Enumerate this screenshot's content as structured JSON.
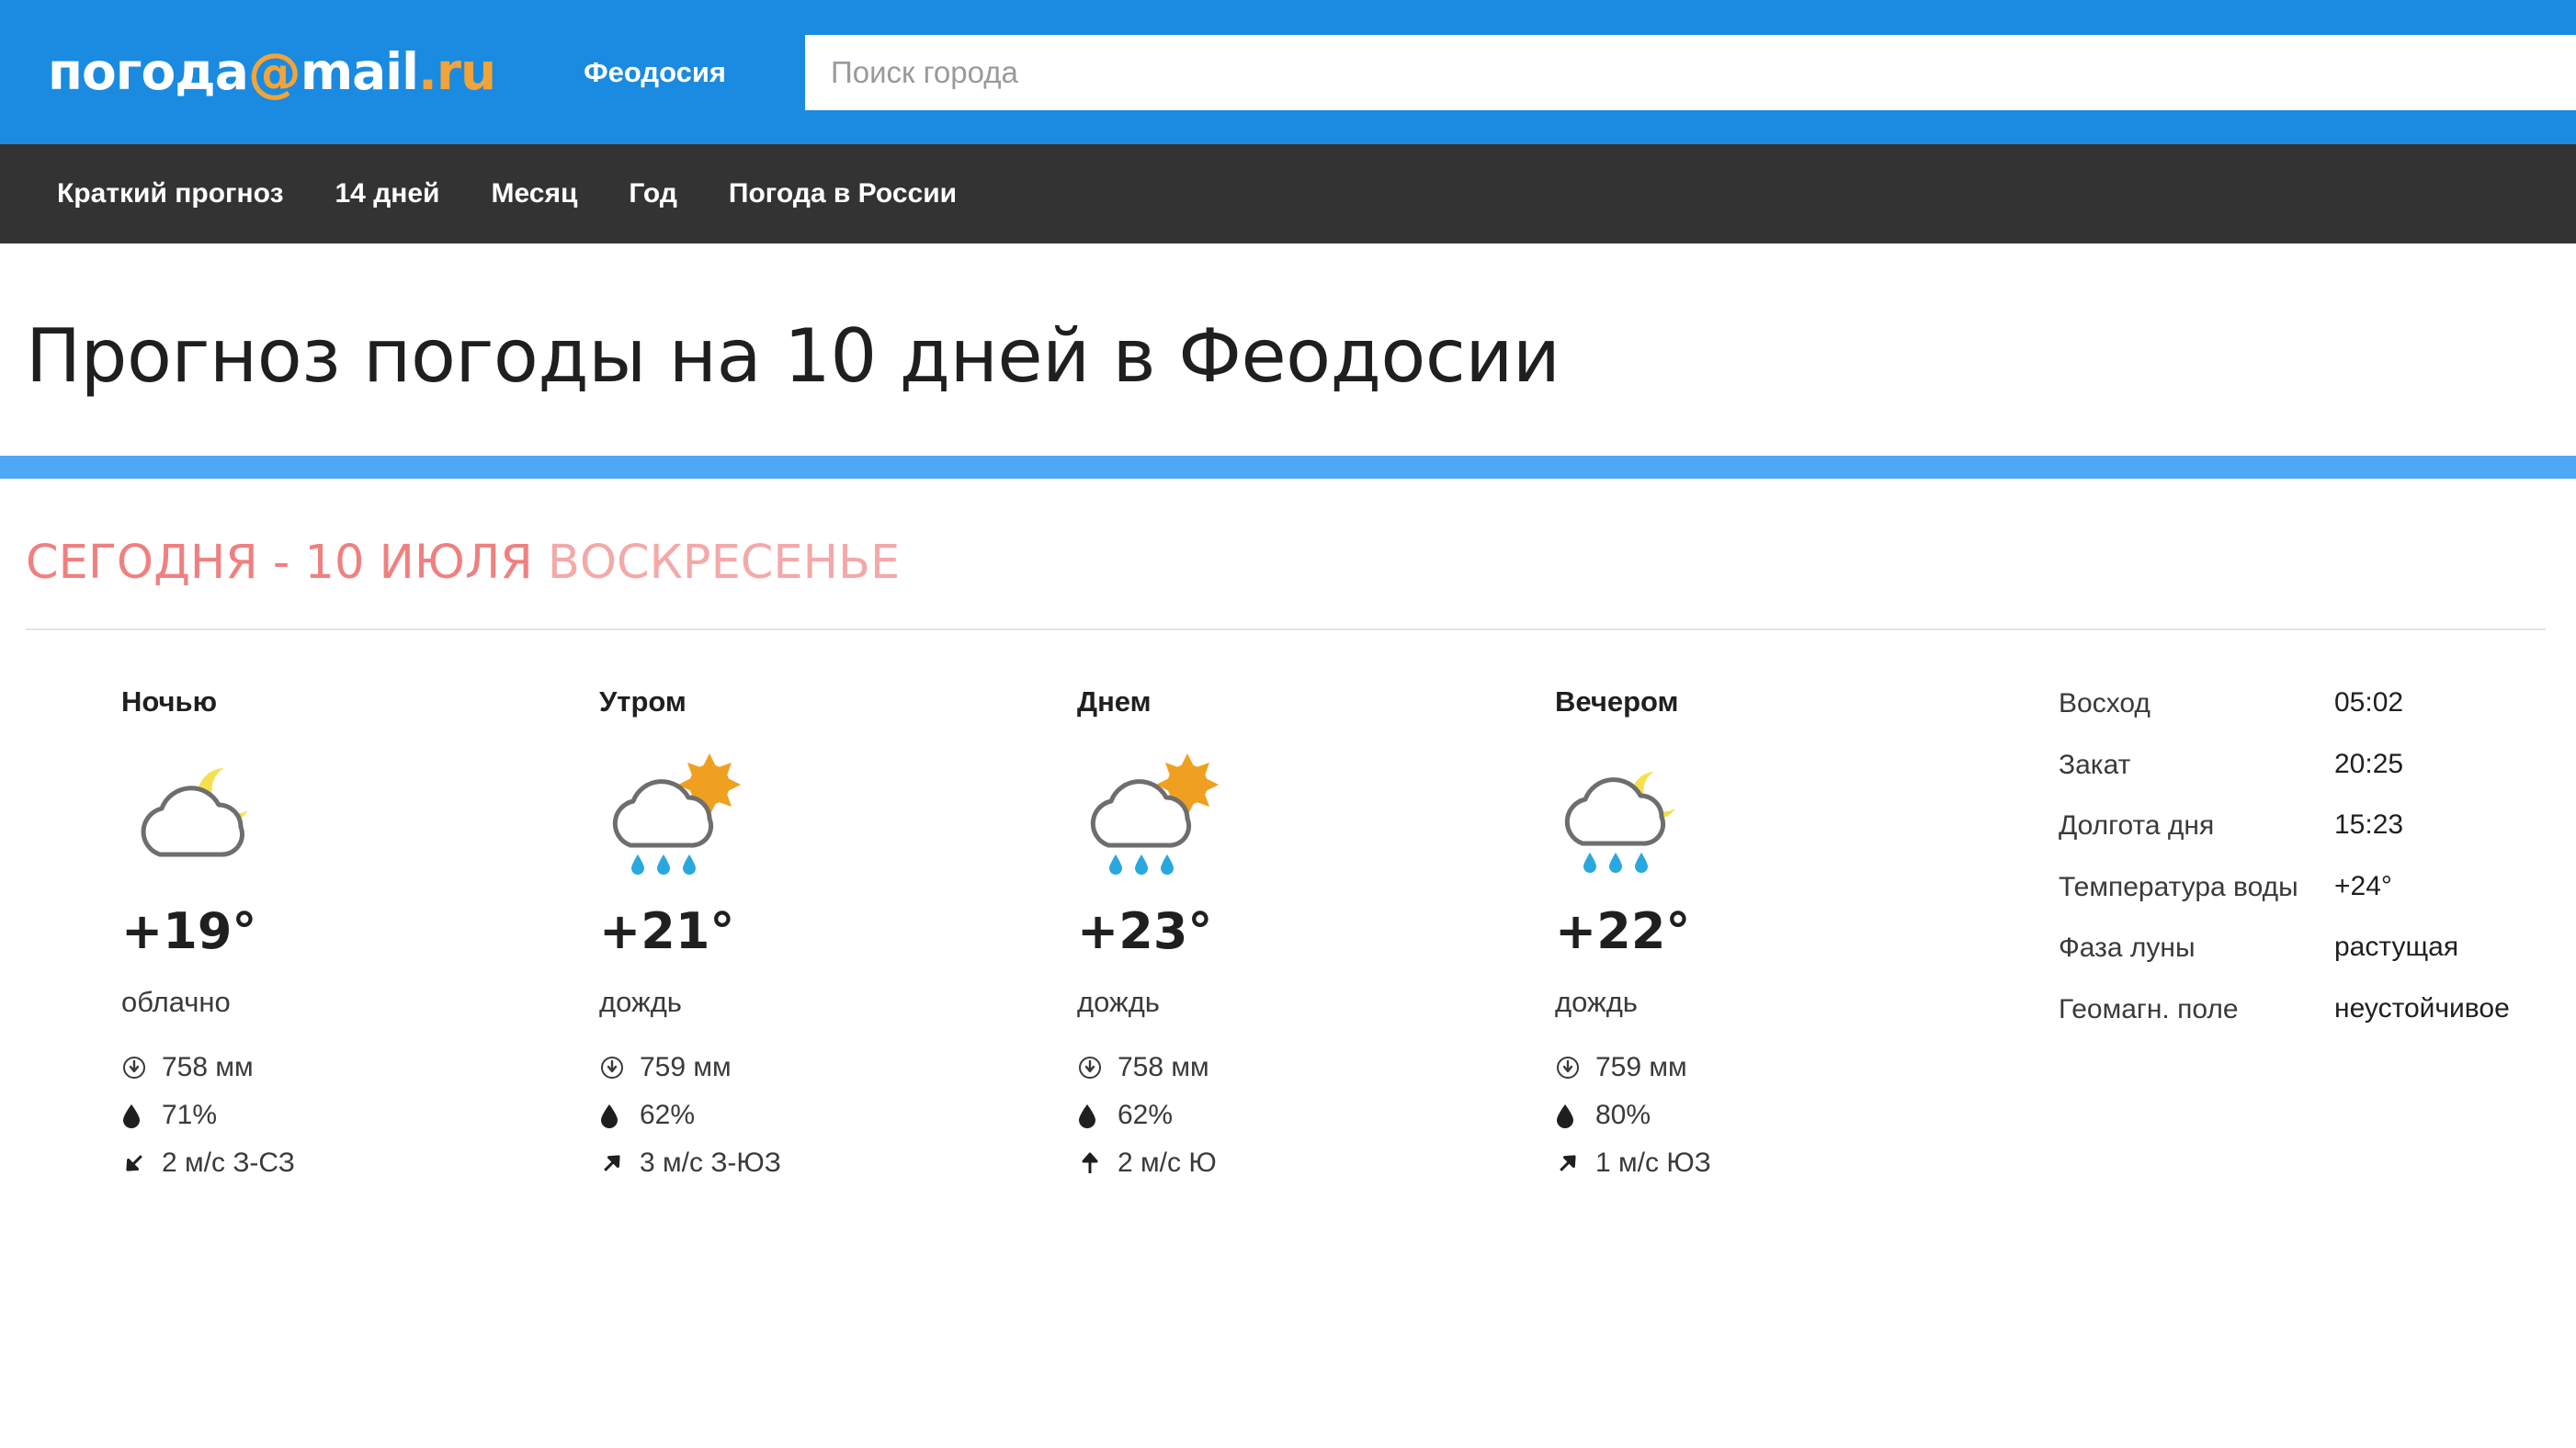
{
  "header": {
    "logo": {
      "prefix": "погода",
      "at": "@",
      "mail": "mail",
      "dot_ru": ".ru"
    },
    "city": "Феодосия",
    "search": {
      "placeholder": "Поиск города",
      "value": ""
    }
  },
  "nav": {
    "items": [
      {
        "label": "Краткий прогноз"
      },
      {
        "label": "14 дней"
      },
      {
        "label": "Месяц"
      },
      {
        "label": "Год"
      },
      {
        "label": "Погода в России"
      }
    ]
  },
  "page": {
    "title": "Прогноз погоды на 10 дней в Феодосии"
  },
  "today": {
    "prefix": "СЕГОДНЯ - 10 ИЮЛЯ",
    "weekday": "ВОСКРЕСЕНЬЕ"
  },
  "forecast": [
    {
      "part": "Ночью",
      "icon": "moon-cloud-icon",
      "temp": "+19°",
      "condition": "облачно",
      "pressure": "758 мм",
      "humidity": "71%",
      "wind": "2 м/с З-СЗ",
      "wind_arrow": "↘"
    },
    {
      "part": "Утром",
      "icon": "sun-cloud-rain-icon",
      "temp": "+21°",
      "condition": "дождь",
      "pressure": "759 мм",
      "humidity": "62%",
      "wind": "3 м/с З-ЮЗ",
      "wind_arrow": "↗"
    },
    {
      "part": "Днем",
      "icon": "sun-cloud-rain-icon",
      "temp": "+23°",
      "condition": "дождь",
      "pressure": "758 мм",
      "humidity": "62%",
      "wind": "2 м/с Ю",
      "wind_arrow": "↑"
    },
    {
      "part": "Вечером",
      "icon": "moon-cloud-rain-icon",
      "temp": "+22°",
      "condition": "дождь",
      "pressure": "759 мм",
      "humidity": "80%",
      "wind": "1 м/с ЮЗ",
      "wind_arrow": "↗"
    }
  ],
  "astro": [
    {
      "label": "Восход",
      "value": "05:02"
    },
    {
      "label": "Закат",
      "value": "20:25"
    },
    {
      "label": "Долгота дня",
      "value": "15:23"
    },
    {
      "label": "Температура воды",
      "value": "+24°"
    },
    {
      "label": "Фаза луны",
      "value": "растущая"
    },
    {
      "label": "Геомагн. поле",
      "value": "неустойчивое"
    }
  ],
  "colors": {
    "header_blue": "#1A8BE0",
    "nav_dark": "#333333",
    "rule_blue": "#4FA8F5",
    "accent_orange": "#F2A43A",
    "today_red": "#F08080",
    "today_red_light": "#F4A9A9",
    "sun_yellow": "#F0A020",
    "moon_yellow": "#F7E04F",
    "rain_blue": "#29A8E0",
    "cloud_stroke": "#6E6E6E"
  }
}
